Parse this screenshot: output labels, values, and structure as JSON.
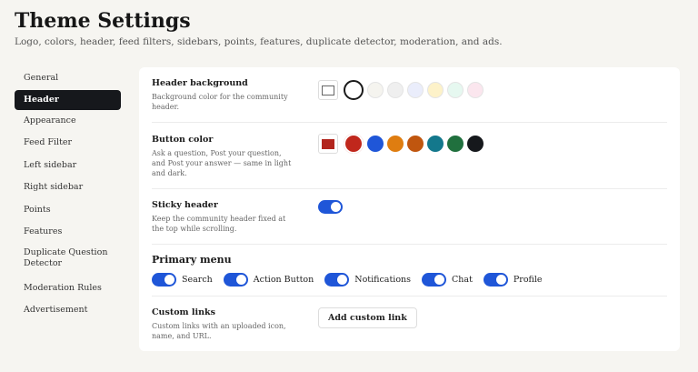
{
  "page": {
    "title": "Theme Settings",
    "subtitle": "Logo, colors, header, feed filters, sidebars, points, features, duplicate detector, moderation, and ads."
  },
  "sidebar": {
    "items": [
      {
        "label": "General"
      },
      {
        "label": "Header",
        "active": true
      },
      {
        "label": "Appearance"
      },
      {
        "label": "Feed Filter"
      },
      {
        "label": "Left sidebar"
      },
      {
        "label": "Right sidebar"
      },
      {
        "label": "Points"
      },
      {
        "label": "Features"
      },
      {
        "label": "Duplicate Question Detector"
      },
      {
        "label": "Moderation Rules"
      },
      {
        "label": "Advertisement"
      }
    ]
  },
  "header_background": {
    "title": "Header background",
    "description": "Background color for the community header.",
    "current_color": "#ffffff",
    "swatches": [
      "#ffffff",
      "#f5f4ef",
      "#efefef",
      "#eaedfb",
      "#fdf2c9",
      "#e6f8f0",
      "#fbe6ee"
    ],
    "selected_index": 0
  },
  "button_color": {
    "title": "Button color",
    "description": "Ask a question, Post your question, and Post your answer — same in light and dark.",
    "current_color": "#b2251d",
    "swatches": [
      "#c0271c",
      "#1f56d8",
      "#df7d10",
      "#c0560f",
      "#13788c",
      "#20703e",
      "#16181c"
    ],
    "selected_index": 0
  },
  "sticky_header": {
    "title": "Sticky header",
    "description": "Keep the community header fixed at the top while scrolling.",
    "enabled": true
  },
  "primary_menu": {
    "heading": "Primary menu",
    "items": [
      {
        "label": "Search",
        "enabled": true
      },
      {
        "label": "Action Button",
        "enabled": true
      },
      {
        "label": "Notifications",
        "enabled": true
      },
      {
        "label": "Chat",
        "enabled": true
      },
      {
        "label": "Profile",
        "enabled": true
      }
    ]
  },
  "custom_links": {
    "title": "Custom links",
    "description": "Custom links with an uploaded icon, name, and URL.",
    "button_label": "Add custom link"
  },
  "colors": {
    "accent": "#1f56d8",
    "active_nav": "#16181c"
  }
}
